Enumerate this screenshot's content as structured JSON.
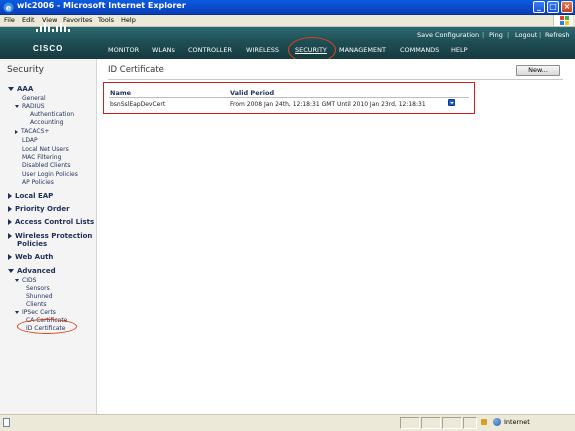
{
  "window": {
    "title": "wlc2006 - Microsoft Internet Explorer",
    "buttons": {
      "minimize": "_",
      "maximize": "□",
      "close": "×"
    }
  },
  "menubar": {
    "items": [
      "File",
      "Edit",
      "View",
      "Favorites",
      "Tools",
      "Help"
    ]
  },
  "header": {
    "logo_text": "CISCO",
    "toplinks": [
      "Save Configuration",
      "Ping",
      "Logout",
      "Refresh"
    ],
    "separator": "|",
    "nav": [
      "MONITOR",
      "WLANs",
      "CONTROLLER",
      "WIRELESS",
      "SECURITY",
      "MANAGEMENT",
      "COMMANDS",
      "HELP"
    ],
    "active_nav": "SECURITY"
  },
  "sidebar": {
    "title": "Security",
    "aaa": "AAA",
    "aaa_items": {
      "general": "General",
      "radius": "RADIUS",
      "authentication": "Authentication",
      "accounting": "Accounting",
      "tacacs": "TACACS+",
      "ldap": "LDAP",
      "local_net_users": "Local Net Users",
      "mac_filtering": "MAC Filtering",
      "disabled_clients": "Disabled Clients",
      "user_login_policies": "User Login Policies",
      "ap_policies": "AP Policies"
    },
    "local_eap": "Local EAP",
    "priority_order": "Priority Order",
    "access_control_lists": "Access Control Lists",
    "wireless_protection_1": "Wireless Protection",
    "wireless_protection_2": "Policies",
    "web_auth": "Web Auth",
    "advanced": "Advanced",
    "advanced_items": {
      "cids": "CIDS",
      "sensors": "Sensors",
      "shunned_clients_1": "Shunned",
      "shunned_clients_2": "Clients",
      "ipsec_certs": "IPSec Certs",
      "ca_certificate": "CA Certificate",
      "id_certificate": "ID Certificate"
    }
  },
  "main": {
    "page_title": "ID Certificate",
    "new_button": "New...",
    "table": {
      "headers": [
        "Name",
        "Valid Period"
      ],
      "rows": [
        {
          "name": "bsnSslEapDevCert",
          "valid_period": "From 2008 Jan 24th, 12:18:31 GMT  Until 2010 Jan 23rd, 12:18:31"
        }
      ]
    }
  },
  "statusbar": {
    "zone": "Internet"
  },
  "colors": {
    "header_teal": "#1f4f55",
    "highlight_red": "#cc2020",
    "xp_blue": "#0b49c8"
  },
  "icons": [
    "ie-icon",
    "minimize-icon",
    "maximize-icon",
    "close-icon",
    "cisco-logo",
    "dropdown-arrow-icon",
    "lock-icon",
    "globe-icon",
    "page-icon"
  ]
}
